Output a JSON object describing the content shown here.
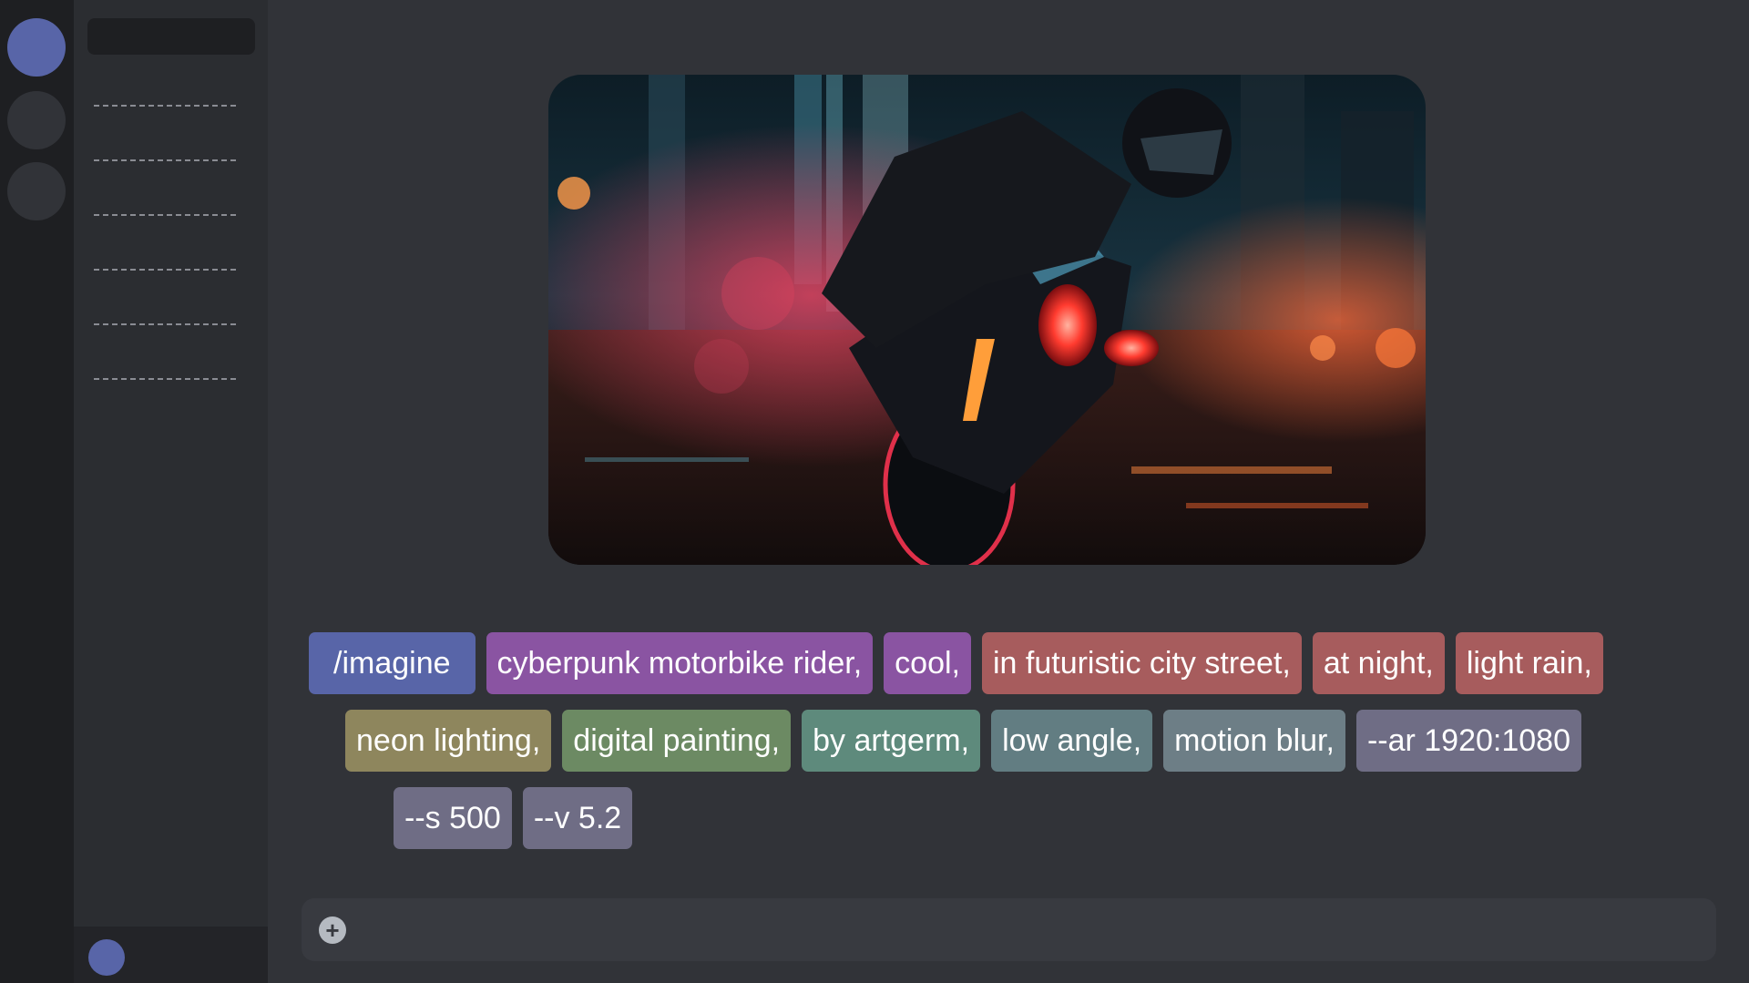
{
  "prompt": {
    "rows": [
      [
        {
          "text": "/imagine",
          "kind": "command",
          "color": "#5865a8"
        },
        {
          "text": "cyberpunk motorbike rider,",
          "kind": "subject",
          "color": "#8a54a2"
        },
        {
          "text": "cool,",
          "kind": "subject",
          "color": "#8a54a2"
        },
        {
          "text": "in futuristic city street,",
          "kind": "setting",
          "color": "#a75c5d"
        },
        {
          "text": "at night,",
          "kind": "setting",
          "color": "#a75c5d"
        },
        {
          "text": "light rain,",
          "kind": "setting",
          "color": "#a75c5d"
        }
      ],
      [
        {
          "text": "neon lighting,",
          "kind": "lighting",
          "color": "#8e865d"
        },
        {
          "text": "digital painting,",
          "kind": "style",
          "color": "#6c8a63"
        },
        {
          "text": "by artgerm,",
          "kind": "style",
          "color": "#5e8a7c"
        },
        {
          "text": "low angle,",
          "kind": "camera",
          "color": "#627d82"
        },
        {
          "text": "motion blur,",
          "kind": "camera",
          "color": "#6d7e86"
        },
        {
          "text": "--ar 1920:1080",
          "kind": "parameter",
          "color": "#6f6d85"
        }
      ],
      [
        {
          "text": "--s 500",
          "kind": "parameter",
          "color": "#6f6d85"
        },
        {
          "text": "--v 5.2",
          "kind": "parameter",
          "color": "#6f6d85"
        }
      ]
    ]
  },
  "composer": {
    "add_icon": "plus-circle-icon",
    "add_glyph": "+"
  },
  "colors": {
    "accent": "#5865a8",
    "background": "#313338",
    "sidebar": "#2b2d31",
    "rail": "#1e1f22"
  }
}
